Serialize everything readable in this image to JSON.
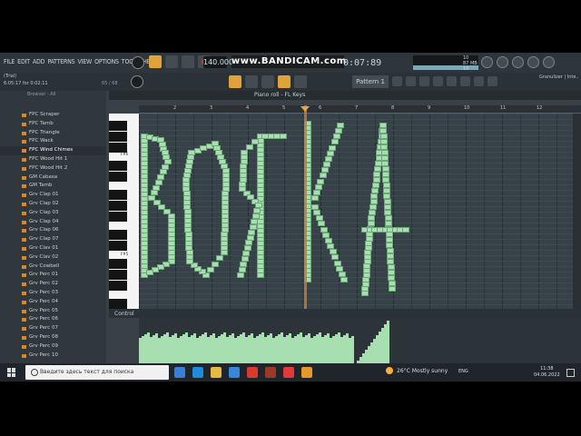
{
  "menu": [
    "FILE",
    "EDIT",
    "ADD",
    "PATTERNS",
    "VIEW",
    "OPTIONS",
    "TOOLS",
    "HELP"
  ],
  "transport": {
    "tempo": "140.000",
    "time": "0:07:89",
    "watermark": "www.BANDICAM.com"
  },
  "hint": {
    "title": "(Trial)",
    "value": "6:05:17 for 0:02:11",
    "count": "65 / 68"
  },
  "cpu": {
    "line1": "10",
    "line2": "87 MB",
    "line3": "19"
  },
  "pattern": {
    "selector": "Pattern 1",
    "plugin": "Granulizer | Inte.."
  },
  "browser": {
    "header": "Browser - All",
    "items": [
      "FPC Scraper",
      "FPC Tamb",
      "FPC Triangle",
      "FPC Wack",
      "FPC Wind Chimes",
      "FPC Wood Hit 1",
      "FPC Wood Hit 2",
      "GM Cabasa",
      "GM Tamb",
      "Grv Clap 01",
      "Grv Clap 02",
      "Grv Clap 03",
      "Grv Clap 04",
      "Grv Clap 06",
      "Grv Clap 07",
      "Grv Clav 01",
      "Grv Clav 02",
      "Grv Cowbell",
      "Grv Perc 01",
      "Grv Perc 02",
      "Grv Perc 03",
      "Grv Perc 04",
      "Grv Perc 05",
      "Grv Perc 06",
      "Grv Perc 07",
      "Grv Perc 08",
      "Grv Perc 09",
      "Grv Perc 10"
    ],
    "selected": "FPC Wind Chimes"
  },
  "piano_roll": {
    "title": "Piano roll - FL Keys",
    "key_labels": [
      "F#6",
      "F#5"
    ],
    "bars": [
      "2",
      "3",
      "4",
      "5",
      "6",
      "7",
      "8",
      "9",
      "10",
      "11",
      "12"
    ],
    "control_label": "Control"
  },
  "taskbar": {
    "search_placeholder": "Введите здесь текст для поиска",
    "weather": "26°C  Mostly sunny",
    "lang": "ENG",
    "time": "11:38",
    "date": "04.06.2022"
  }
}
